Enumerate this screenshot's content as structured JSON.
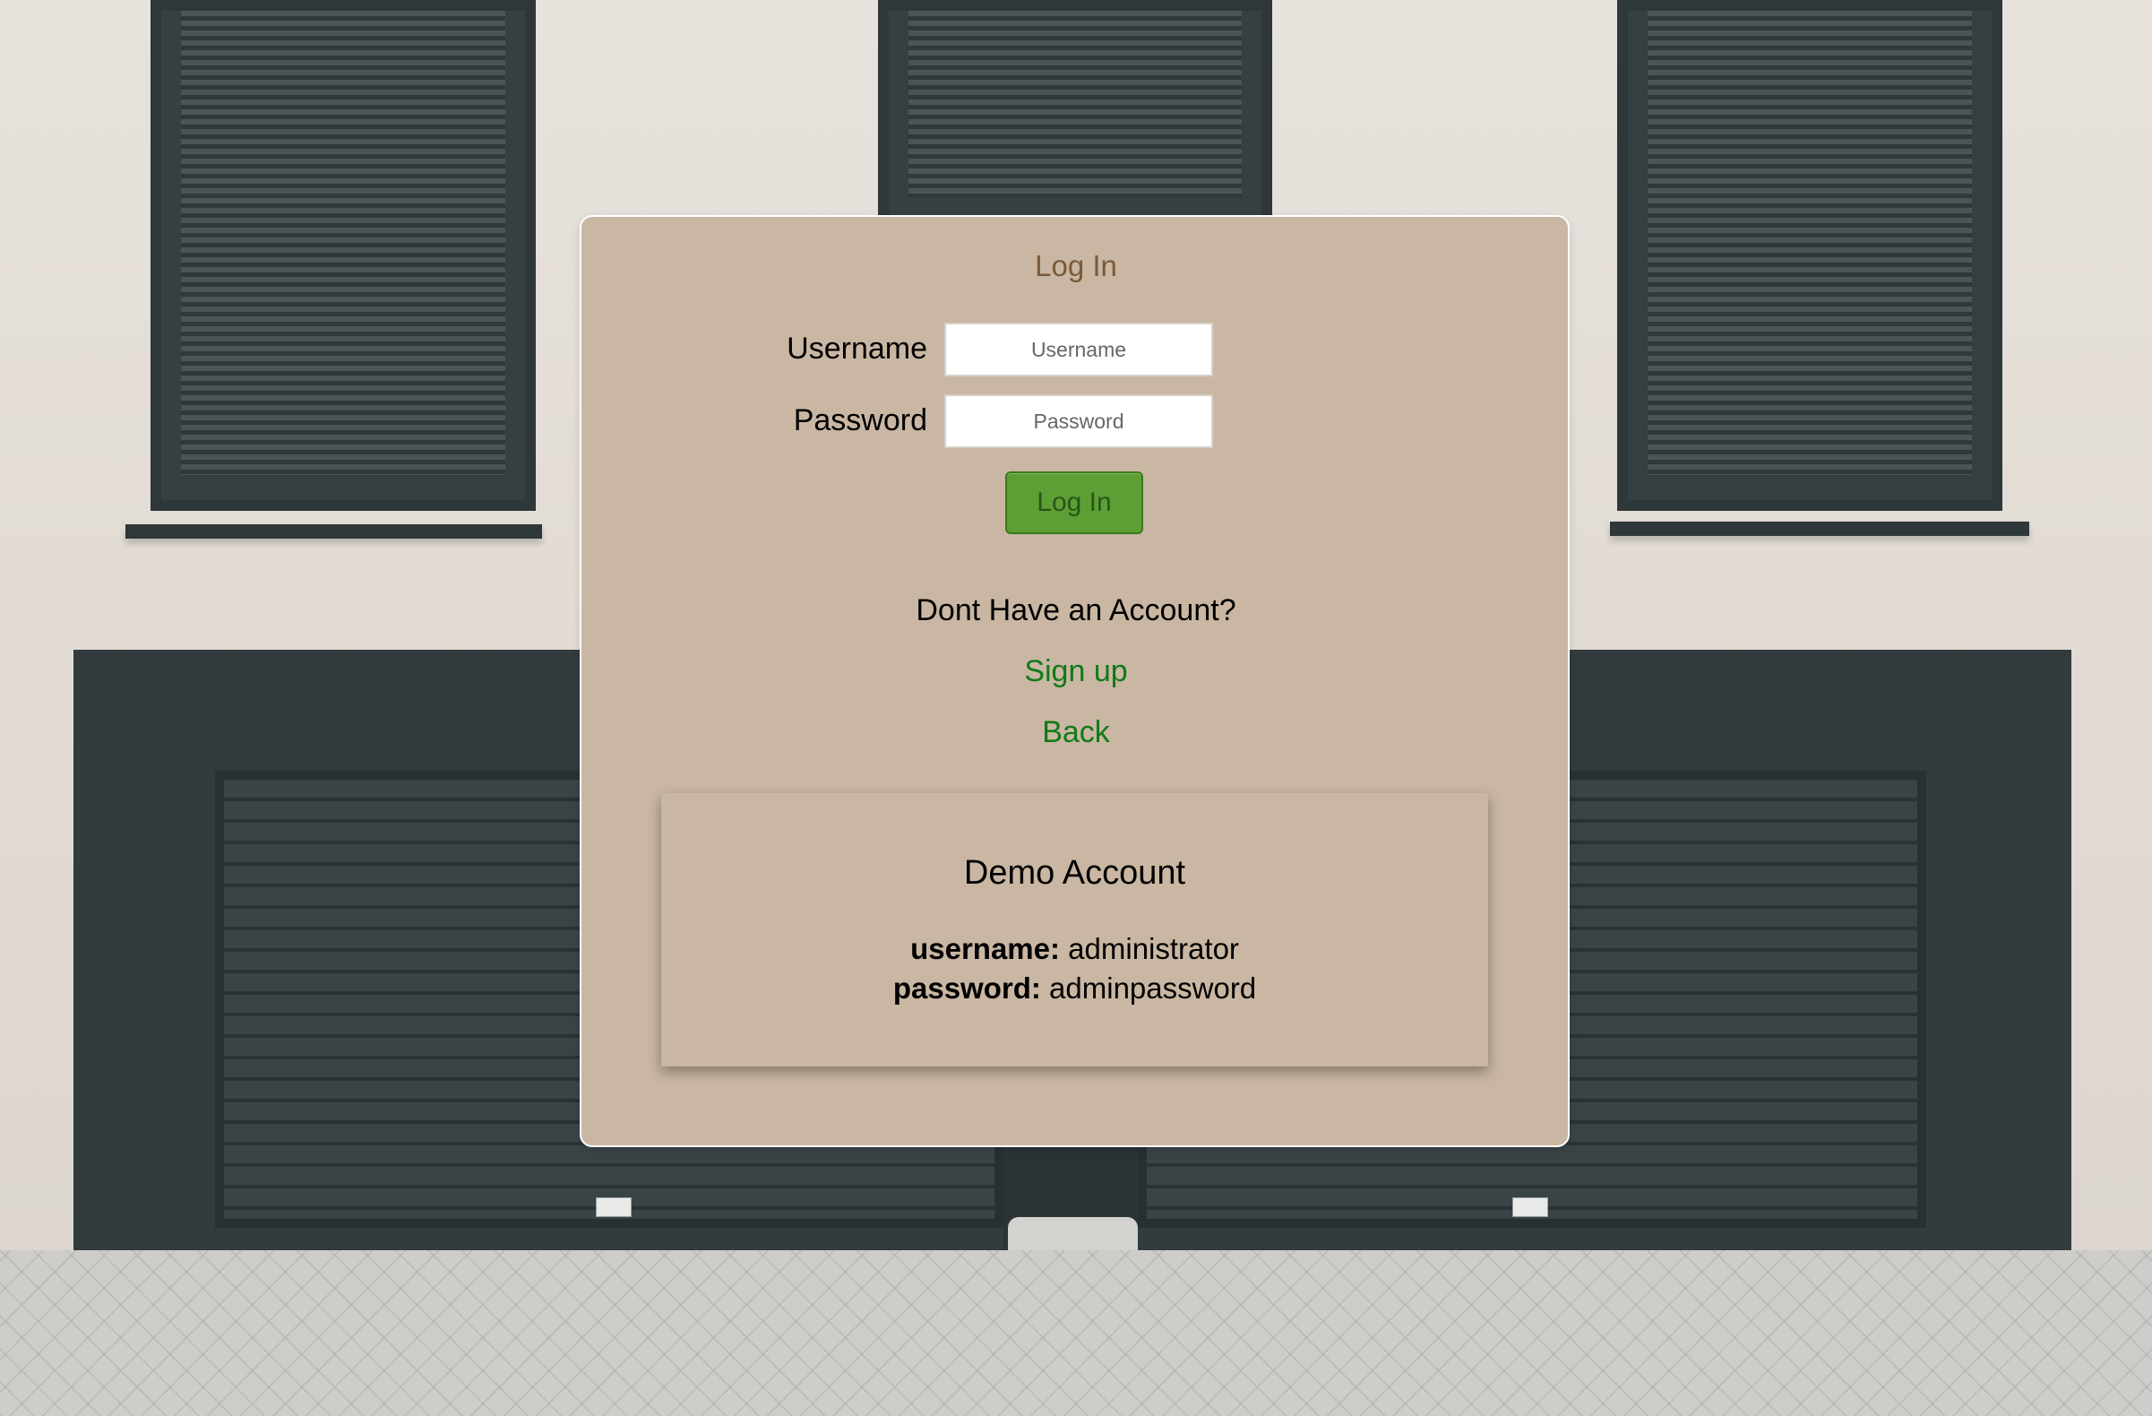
{
  "login_card": {
    "title": "Log In",
    "username_label": "Username",
    "username_placeholder": "Username",
    "password_label": "Password",
    "password_placeholder": "Password",
    "login_button_label": "Log In",
    "no_account_prompt": "Dont Have an Account?",
    "signup_link": "Sign up",
    "back_link": "Back"
  },
  "demo_account": {
    "title": "Demo Account",
    "username_key": "username:",
    "username_value": "administrator",
    "password_key": "password:",
    "password_value": "adminpassword"
  },
  "colors": {
    "card_background": "#c9b7a3",
    "title_color": "#7a5a3a",
    "button_green": "#5e9f35",
    "link_green": "#117a17"
  }
}
